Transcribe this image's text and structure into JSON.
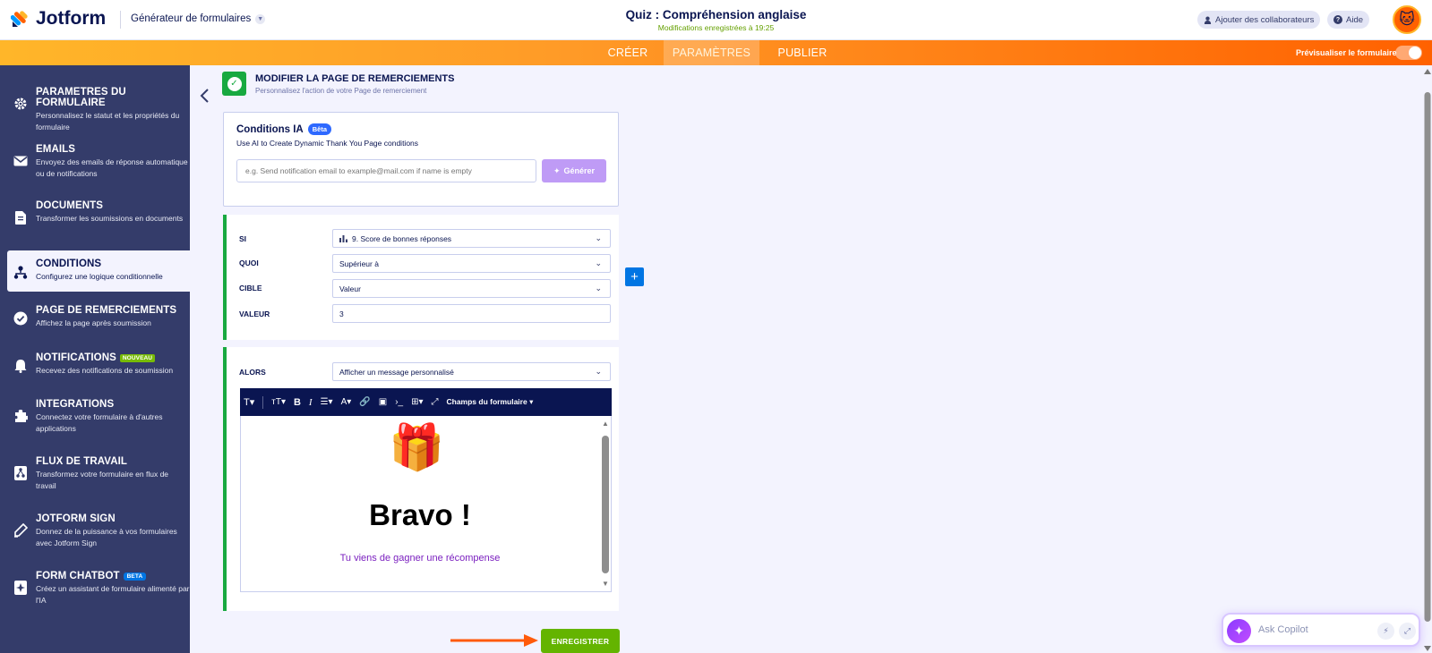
{
  "header": {
    "logo_text": "Jotform",
    "builder_label": "Générateur de formulaires",
    "form_title": "Quiz : Compréhension anglaise",
    "saved_status": "Modifications enregistrées à 19:25",
    "add_collaborators": "Ajouter des collaborateurs",
    "help": "Aide"
  },
  "nav": {
    "tabs": [
      "CRÉER",
      "PARAMÈTRES",
      "PUBLIER"
    ],
    "active_tab": "PARAMÈTRES",
    "preview_label": "Prévisualiser le formulaire"
  },
  "sidebar": {
    "items": [
      {
        "title": "PARAMETRES DU FORMULAIRE",
        "desc": "Personnalisez le statut et les propriétés du formulaire",
        "icon": "gear-icon"
      },
      {
        "title": "EMAILS",
        "desc": "Envoyez des emails de réponse automatique ou de notifications",
        "icon": "envelope-icon"
      },
      {
        "title": "DOCUMENTS",
        "desc": "Transformer les soumissions en documents",
        "icon": "document-icon"
      },
      {
        "title": "CONDITIONS",
        "desc": "Configurez une logique conditionnelle",
        "icon": "hierarchy-icon"
      },
      {
        "title": "PAGE DE REMERCIEMENTS",
        "desc": "Affichez la page après soumission",
        "icon": "check-circle-icon"
      },
      {
        "title": "NOTIFICATIONS",
        "desc": "Recevez des notifications de soumission",
        "icon": "bell-icon",
        "badge": "NOUVEAU"
      },
      {
        "title": "INTEGRATIONS",
        "desc": "Connectez votre formulaire à d'autres applications",
        "icon": "puzzle-icon"
      },
      {
        "title": "FLUX DE TRAVAIL",
        "desc": "Transformez votre formulaire en flux de travail",
        "icon": "workflow-icon"
      },
      {
        "title": "JOTFORM SIGN",
        "desc": "Donnez de la puissance à vos formulaires avec Jotform Sign",
        "icon": "pen-icon"
      },
      {
        "title": "FORM CHATBOT",
        "desc": "Créez un assistant de formulaire alimenté par l'IA",
        "icon": "chatbot-icon",
        "badge": "BETA"
      }
    ],
    "active": "CONDITIONS"
  },
  "section": {
    "title": "MODIFIER LA PAGE DE REMERCIEMENTS",
    "subtitle": "Personnalisez l'action de votre Page de remerciement"
  },
  "ai_conditions": {
    "title": "Conditions IA",
    "badge": "Bêta",
    "subtitle": "Use AI to Create Dynamic Thank You Page conditions",
    "placeholder": "e.g. Send notification email to example@mail.com if name is empty",
    "generate": "Générer"
  },
  "condition": {
    "if_label": "SI",
    "if_value": "9. Score de bonnes réponses",
    "what_label": "QUOI",
    "what_value": "Supérieur à",
    "target_label": "CIBLE",
    "target_value": "Valeur",
    "value_label": "VALEUR",
    "value_value": "3"
  },
  "action": {
    "then_label": "ALORS",
    "then_value": "Afficher un message personnalisé",
    "form_fields": "Champs du formulaire",
    "heading": "Bravo !",
    "message": "Tu viens de gagner une récompense"
  },
  "save_button": "ENREGISTRER",
  "copilot": {
    "placeholder": "Ask Copilot"
  },
  "colors": {
    "accent_orange": "#ff6100",
    "green": "#18a940",
    "save_green": "#64b400",
    "blue": "#0075e3",
    "sidebar": "#343c6a"
  }
}
